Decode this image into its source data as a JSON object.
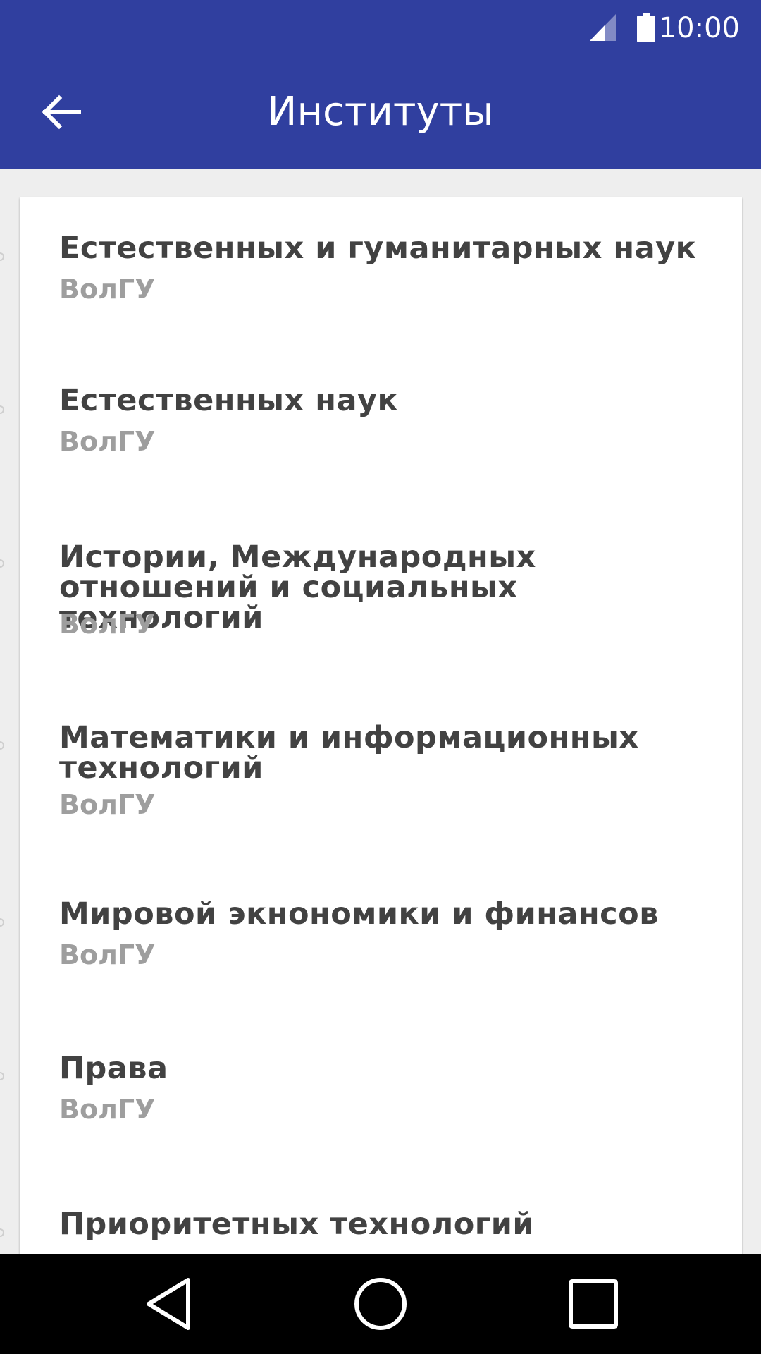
{
  "status_bar": {
    "time": "10:00",
    "signal_icon": "signal-icon",
    "battery_icon": "battery-icon"
  },
  "app_bar": {
    "title": "Институты",
    "back_icon": "arrow-back-icon",
    "color": "#303f9f"
  },
  "institutes": [
    {
      "name": "Естественных и гуманитарных наук",
      "university": "ВолГУ"
    },
    {
      "name": "Естественных наук",
      "university": "ВолГУ"
    },
    {
      "name": "Истории, Международных отношений и социальных технологий",
      "university": "ВолГУ"
    },
    {
      "name": "Математики и информационных технологий",
      "university": "ВолГУ"
    },
    {
      "name": "Мировой экнономики и финансов",
      "university": "ВолГУ"
    },
    {
      "name": "Права",
      "university": "ВолГУ"
    },
    {
      "name": "Приоритетных технологий",
      "university": ""
    }
  ],
  "nav_bar": {
    "back_icon": "nav-back-icon",
    "home_icon": "nav-home-icon",
    "recents_icon": "nav-recents-icon"
  }
}
